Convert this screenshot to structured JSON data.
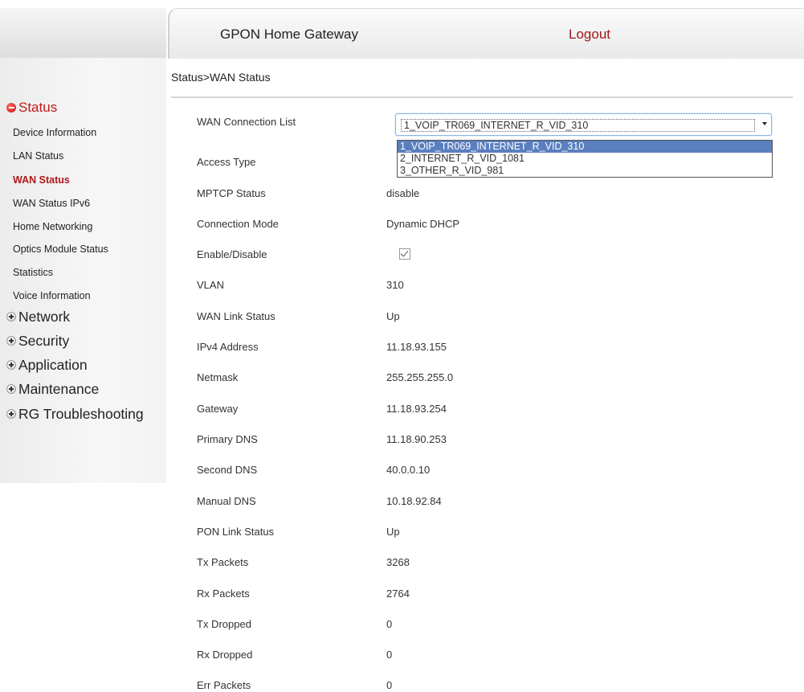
{
  "header": {
    "title": "GPON Home Gateway",
    "logout": "Logout"
  },
  "breadcrumb": "Status>WAN Status",
  "sidebar": {
    "status_label": "Status",
    "status_items": [
      "Device Information",
      "LAN Status",
      "WAN Status",
      "WAN Status IPv6",
      "Home Networking",
      "Optics Module Status",
      "Statistics",
      "Voice Information"
    ],
    "active_item": "WAN Status",
    "categories": [
      "Network",
      "Security",
      "Application",
      "Maintenance",
      "RG Troubleshooting"
    ]
  },
  "wan": {
    "connection_list_label": "WAN Connection List",
    "selected": "1_VOIP_TR069_INTERNET_R_VID_310",
    "options": [
      "1_VOIP_TR069_INTERNET_R_VID_310",
      "2_INTERNET_R_VID_1081",
      "3_OTHER_R_VID_981"
    ],
    "rows": [
      {
        "label": "Access Type",
        "value": ""
      },
      {
        "label": "MPTCP Status",
        "value": "disable"
      },
      {
        "label": "Connection Mode",
        "value": "Dynamic DHCP"
      },
      {
        "label": "Enable/Disable",
        "value": ""
      },
      {
        "label": "VLAN",
        "value": "310"
      },
      {
        "label": "WAN Link Status",
        "value": "Up"
      },
      {
        "label": "IPv4 Address",
        "value": "11.18.93.155"
      },
      {
        "label": "Netmask",
        "value": "255.255.255.0"
      },
      {
        "label": "Gateway",
        "value": "11.18.93.254"
      },
      {
        "label": "Primary DNS",
        "value": "11.18.90.253"
      },
      {
        "label": "Second DNS",
        "value": "40.0.0.10"
      },
      {
        "label": "Manual DNS",
        "value": "10.18.92.84"
      },
      {
        "label": "PON Link Status",
        "value": "Up"
      },
      {
        "label": "Tx Packets",
        "value": "3268"
      },
      {
        "label": "Rx Packets",
        "value": "2764"
      },
      {
        "label": "Tx Dropped",
        "value": "0"
      },
      {
        "label": "Rx Dropped",
        "value": "0"
      },
      {
        "label": "Err Packets",
        "value": "0"
      }
    ],
    "enable_checked": true
  },
  "colors": {
    "accent": "#b0181a",
    "logout": "#a01818",
    "dropdown_highlight": "#5a7fbf"
  }
}
